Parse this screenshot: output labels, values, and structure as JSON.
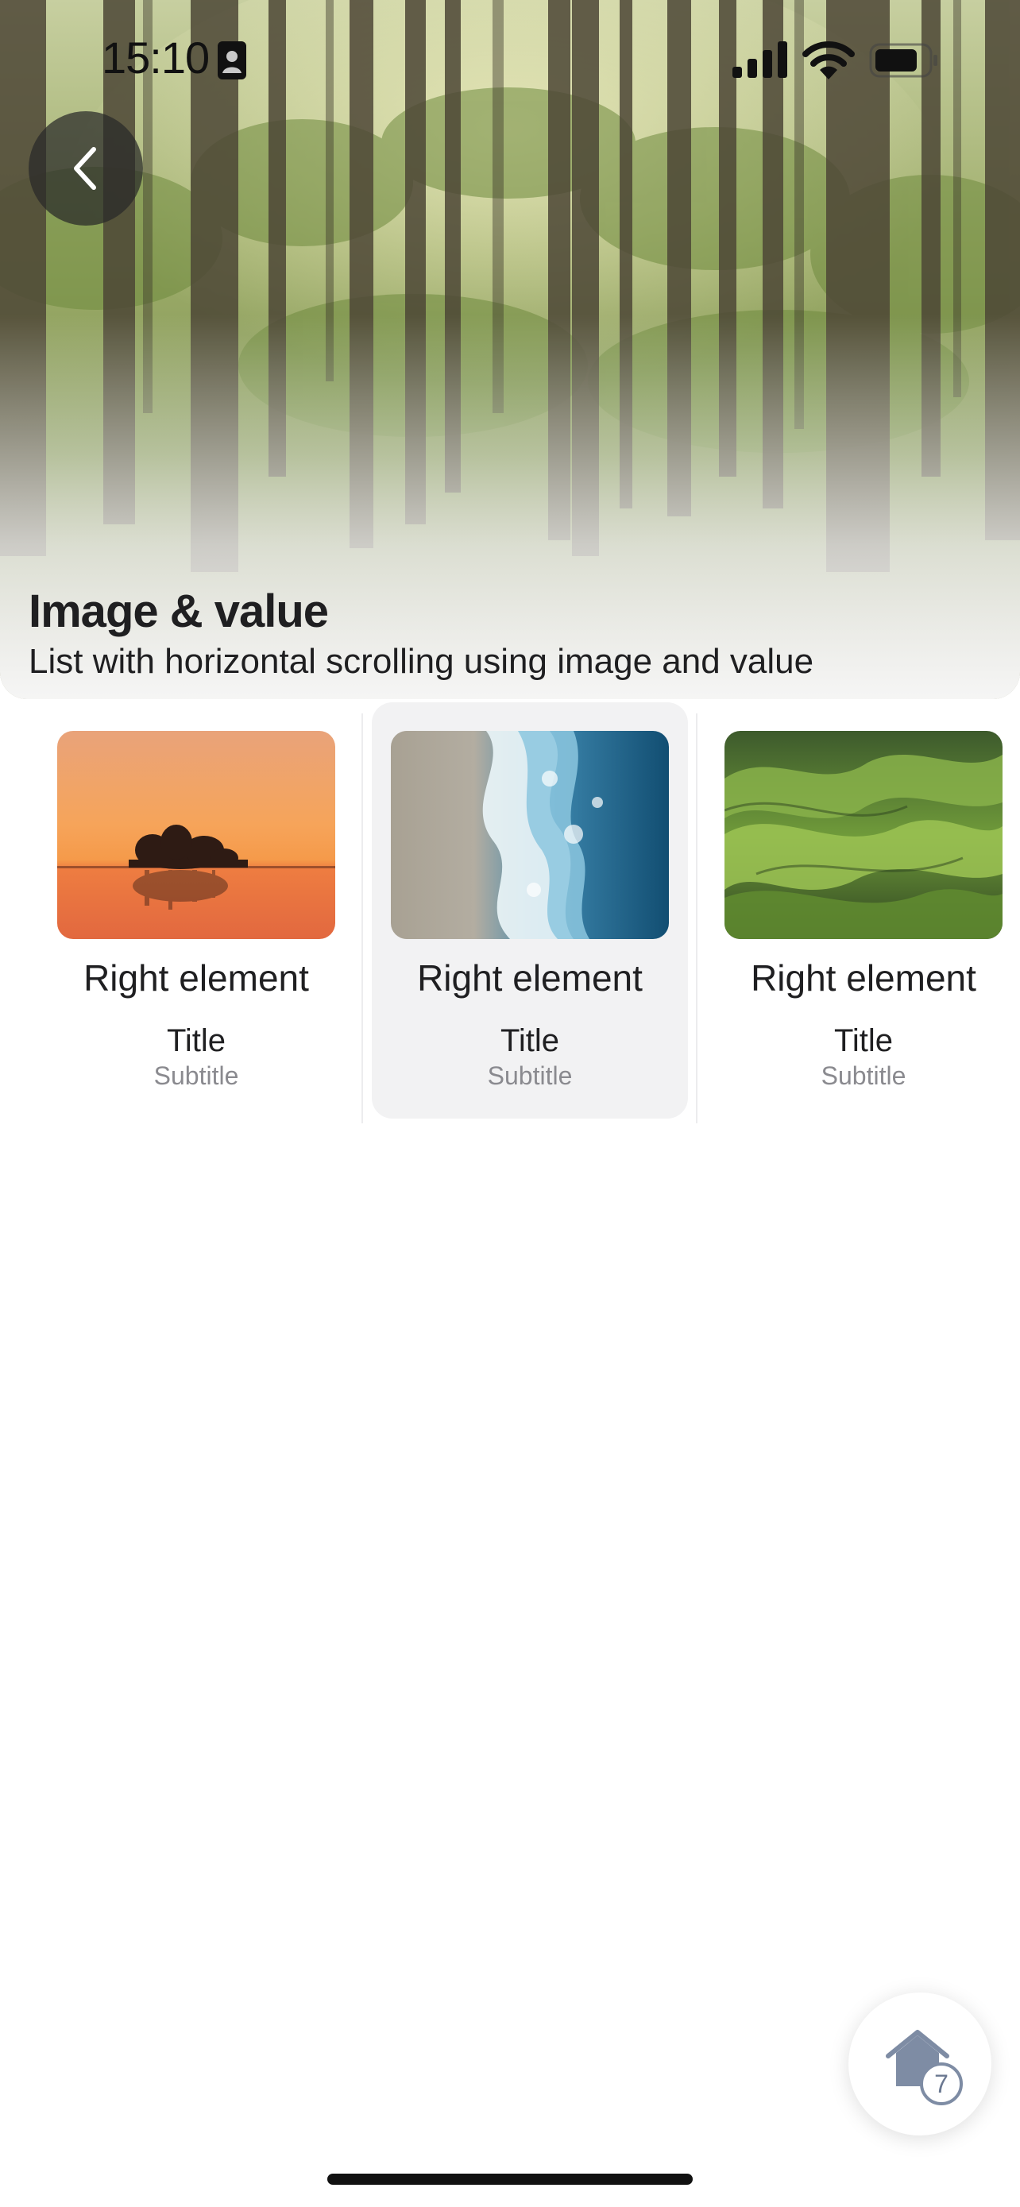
{
  "status_bar": {
    "time": "15:10",
    "icons": [
      "contact-card-icon",
      "signal-icon",
      "wifi-icon",
      "battery-icon"
    ]
  },
  "header": {
    "back_icon": "chevron-left-icon",
    "title": "Image & value",
    "subtitle": "List with horizontal scrolling using image and value"
  },
  "list": {
    "items": [
      {
        "image": "sunset-lake-island",
        "value": "Right element",
        "title": "Title",
        "subtitle": "Subtitle",
        "selected": false
      },
      {
        "image": "ocean-waves-beach",
        "value": "Right element",
        "title": "Title",
        "subtitle": "Subtitle",
        "selected": true
      },
      {
        "image": "green-rolling-hills",
        "value": "Right element",
        "title": "Title",
        "subtitle": "Subtitle",
        "selected": false
      }
    ]
  },
  "fab": {
    "icon": "home-icon",
    "badge": "7"
  },
  "colors": {
    "selected_card_bg": "#f2f2f3",
    "subtitle_gray": "#8a8a8f",
    "badge_stroke": "#7e8ca4"
  }
}
